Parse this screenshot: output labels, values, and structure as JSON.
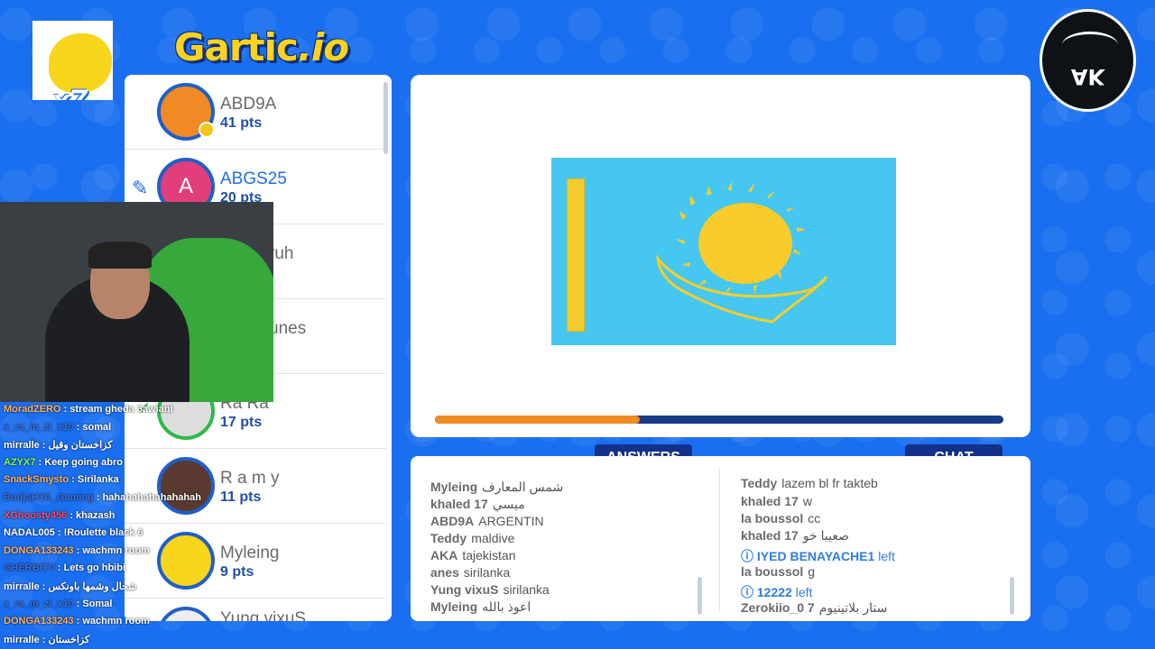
{
  "badge": {
    "multiplier": "x7"
  },
  "logo": {
    "part1": "Gartic",
    "part2": ".io"
  },
  "emblem": {
    "text": "AK"
  },
  "players": [
    {
      "name": "ABD9A",
      "points": "41 pts",
      "avatar_color": "#f08a24"
    },
    {
      "name": "ABGS25",
      "points": "20 pts",
      "avatar_letter": "A",
      "avatar_color": "#e23e7c",
      "drawing": true
    },
    {
      "name": "ruh",
      "points": ""
    },
    {
      "name": "unes",
      "points": ""
    },
    {
      "name": "Ra Ra",
      "points": "17 pts",
      "guessed": true
    },
    {
      "name": "R a m y",
      "points": "11 pts"
    },
    {
      "name": "Myleing",
      "points": "9 pts",
      "avatar_color": "#f8d61b"
    },
    {
      "name": "Yung vixuS",
      "points": ""
    }
  ],
  "canvas": {
    "progress": 0.36
  },
  "tabs": {
    "answers": "ANSWERS",
    "chat": "CHAT"
  },
  "answers": [
    {
      "user": "Myleing",
      "text": "شمس المعارف"
    },
    {
      "user": "khaled 17",
      "text": "ميسي"
    },
    {
      "user": "ABD9A",
      "text": "ARGENTIN"
    },
    {
      "user": "Teddy",
      "text": "maldive"
    },
    {
      "user": "AKA",
      "text": "tajekistan"
    },
    {
      "user": "anes",
      "text": "sirilanka"
    },
    {
      "user": "Yung vixuS",
      "text": "sirilanka"
    },
    {
      "user": "Myleing",
      "text": "اعوذ بالله"
    }
  ],
  "chat": [
    {
      "user": "Teddy",
      "text": "lazem bl fr takteb"
    },
    {
      "user": "khaled 17",
      "text": "w"
    },
    {
      "user": "la boussol",
      "text": "cc"
    },
    {
      "user": "khaled 17",
      "text": "صعيبا خو"
    },
    {
      "user": "IYED BENAYACHE1",
      "text": "left",
      "system": true
    },
    {
      "user": "la boussol",
      "text": "g"
    },
    {
      "user": "12222",
      "text": "left",
      "system": true
    },
    {
      "user": "Zerokiio_0 7",
      "text": "ستار بلاتينيوم"
    }
  ],
  "stream_chat": [
    {
      "user": "MoradZERO",
      "text": ": stream gheda 3awiani",
      "color": "#ffb060"
    },
    {
      "user": "x_ra_m_zi_x10",
      "text": ": somal",
      "color": "#3f6ed8"
    },
    {
      "user": "mirralle",
      "text": ": كزاخستان وقيل",
      "color": "#ffffff"
    },
    {
      "user": "AZYX7",
      "text": ": Keep going abro",
      "color": "#7cff4a"
    },
    {
      "user": "SnackSmysto",
      "text": ": Sirilanka",
      "color": "#ffb060"
    },
    {
      "user": "BodjaHYA_Gaming",
      "text": ": hahahahahahahahah",
      "color": "#3f6ed8"
    },
    {
      "user": "XGhoosty456",
      "text": ": khazash",
      "color": "#ff4a6a"
    },
    {
      "user": "NADAL005",
      "text": ": !Roulette black 6",
      "color": "#ffffff"
    },
    {
      "user": "DONGA133243",
      "text": ": wachmn room",
      "color": "#ffb060"
    },
    {
      "user": "GHERBITV",
      "text": ": Lets go hbibi",
      "color": "#3f6ed8"
    },
    {
      "user": "mirralle",
      "text": ": شحال وشمها باونكس",
      "color": "#ffffff"
    },
    {
      "user": "x_ra_m_zi_x10",
      "text": ": Somal",
      "color": "#3f6ed8"
    },
    {
      "user": "DONGA133243",
      "text": ": wachmn room",
      "color": "#ffb060"
    },
    {
      "user": "mirralle",
      "text": ": كزاخستان",
      "color": "#ffffff"
    }
  ]
}
